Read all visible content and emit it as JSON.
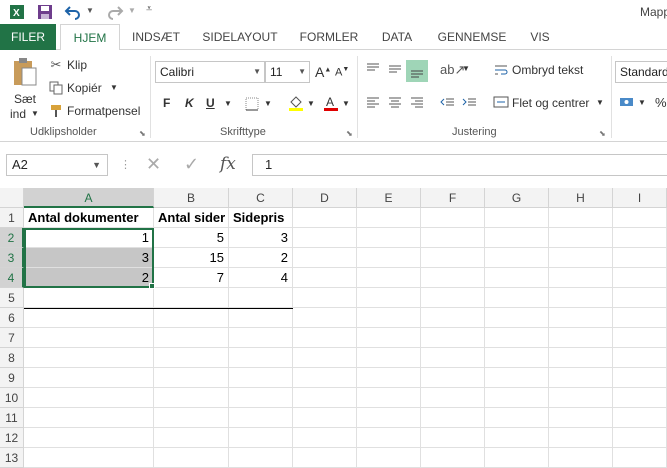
{
  "title": "Mapp",
  "qat": {
    "save_icon": "save-icon",
    "undo_icon": "undo-icon",
    "redo_icon": "redo-icon",
    "customize_icon": "customize-icon"
  },
  "tabs": [
    "FILER",
    "HJEM",
    "INDSÆT",
    "SIDELAYOUT",
    "FORMLER",
    "DATA",
    "GENNEMSE",
    "VIS"
  ],
  "ribbon": {
    "clipboard": {
      "paste": "Sæt",
      "paste2": "ind",
      "cut": "Klip",
      "copy": "Kopiér",
      "format_painter": "Formatpensel",
      "label": "Udklipsholder"
    },
    "font": {
      "name": "Calibri",
      "size": "11",
      "bold": "F",
      "italic": "K",
      "underline": "U",
      "label": "Skrifttype"
    },
    "alignment": {
      "wrap": "Ombryd tekst",
      "merge": "Flet og centrer",
      "label": "Justering"
    },
    "number": {
      "format": "Standard",
      "percent": "%"
    }
  },
  "formula_bar": {
    "name_box": "A2",
    "fx": "fx",
    "value": "1"
  },
  "columns": [
    "A",
    "B",
    "C",
    "D",
    "E",
    "F",
    "G",
    "H",
    "I"
  ],
  "rows": [
    "1",
    "2",
    "3",
    "4",
    "5",
    "6",
    "7",
    "8",
    "9",
    "10",
    "11",
    "12",
    "13"
  ],
  "cells": {
    "A1": "Antal dokumenter",
    "B1": "Antal sider",
    "C1": "Sidepris",
    "A2": "1",
    "B2": "5",
    "C2": "3",
    "A3": "3",
    "B3": "15",
    "C3": "2",
    "A4": "2",
    "B4": "7",
    "C4": "4"
  },
  "colors": {
    "accent": "#217346",
    "selection_fill": "#c6c6c6"
  }
}
